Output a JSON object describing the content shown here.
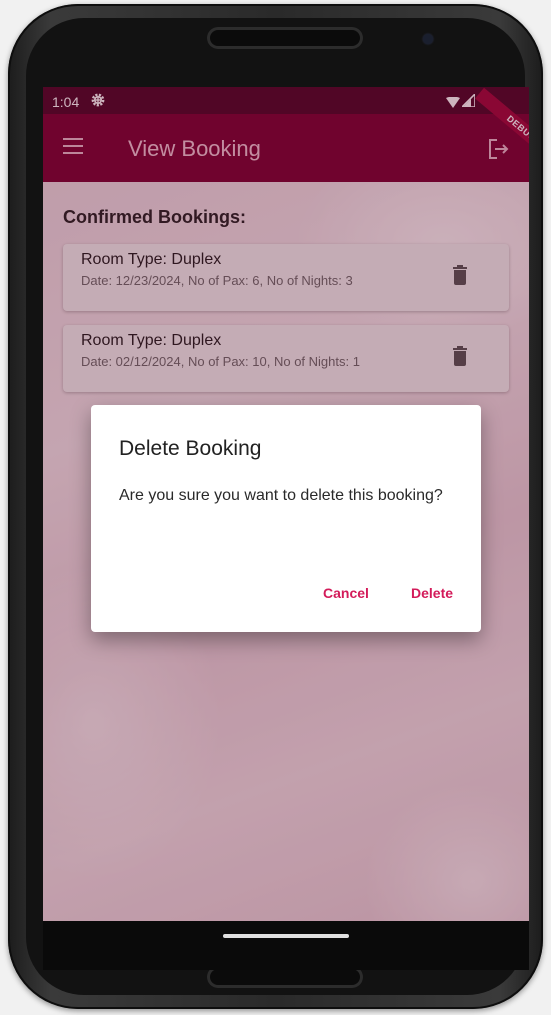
{
  "status_bar": {
    "time": "1:04",
    "debug_label": "DEBUG"
  },
  "app_bar": {
    "title": "View Booking",
    "menu_icon": "hamburger-menu-icon",
    "logout_icon": "logout-icon"
  },
  "content": {
    "section_title": "Confirmed Bookings:",
    "bookings": [
      {
        "title": "Room Type: Duplex",
        "subtitle": "Date: 12/23/2024, No of Pax: 6, No of Nights: 3"
      },
      {
        "title": "Room Type: Duplex",
        "subtitle": "Date: 02/12/2024, No of Pax: 10, No of Nights: 1"
      }
    ]
  },
  "dialog": {
    "title": "Delete Booking",
    "message": "Are you sure you want to delete this booking?",
    "cancel_label": "Cancel",
    "delete_label": "Delete"
  },
  "colors": {
    "app_bar": "#7a0031",
    "status_bar": "#4e0526",
    "accent": "#d31b5a"
  }
}
